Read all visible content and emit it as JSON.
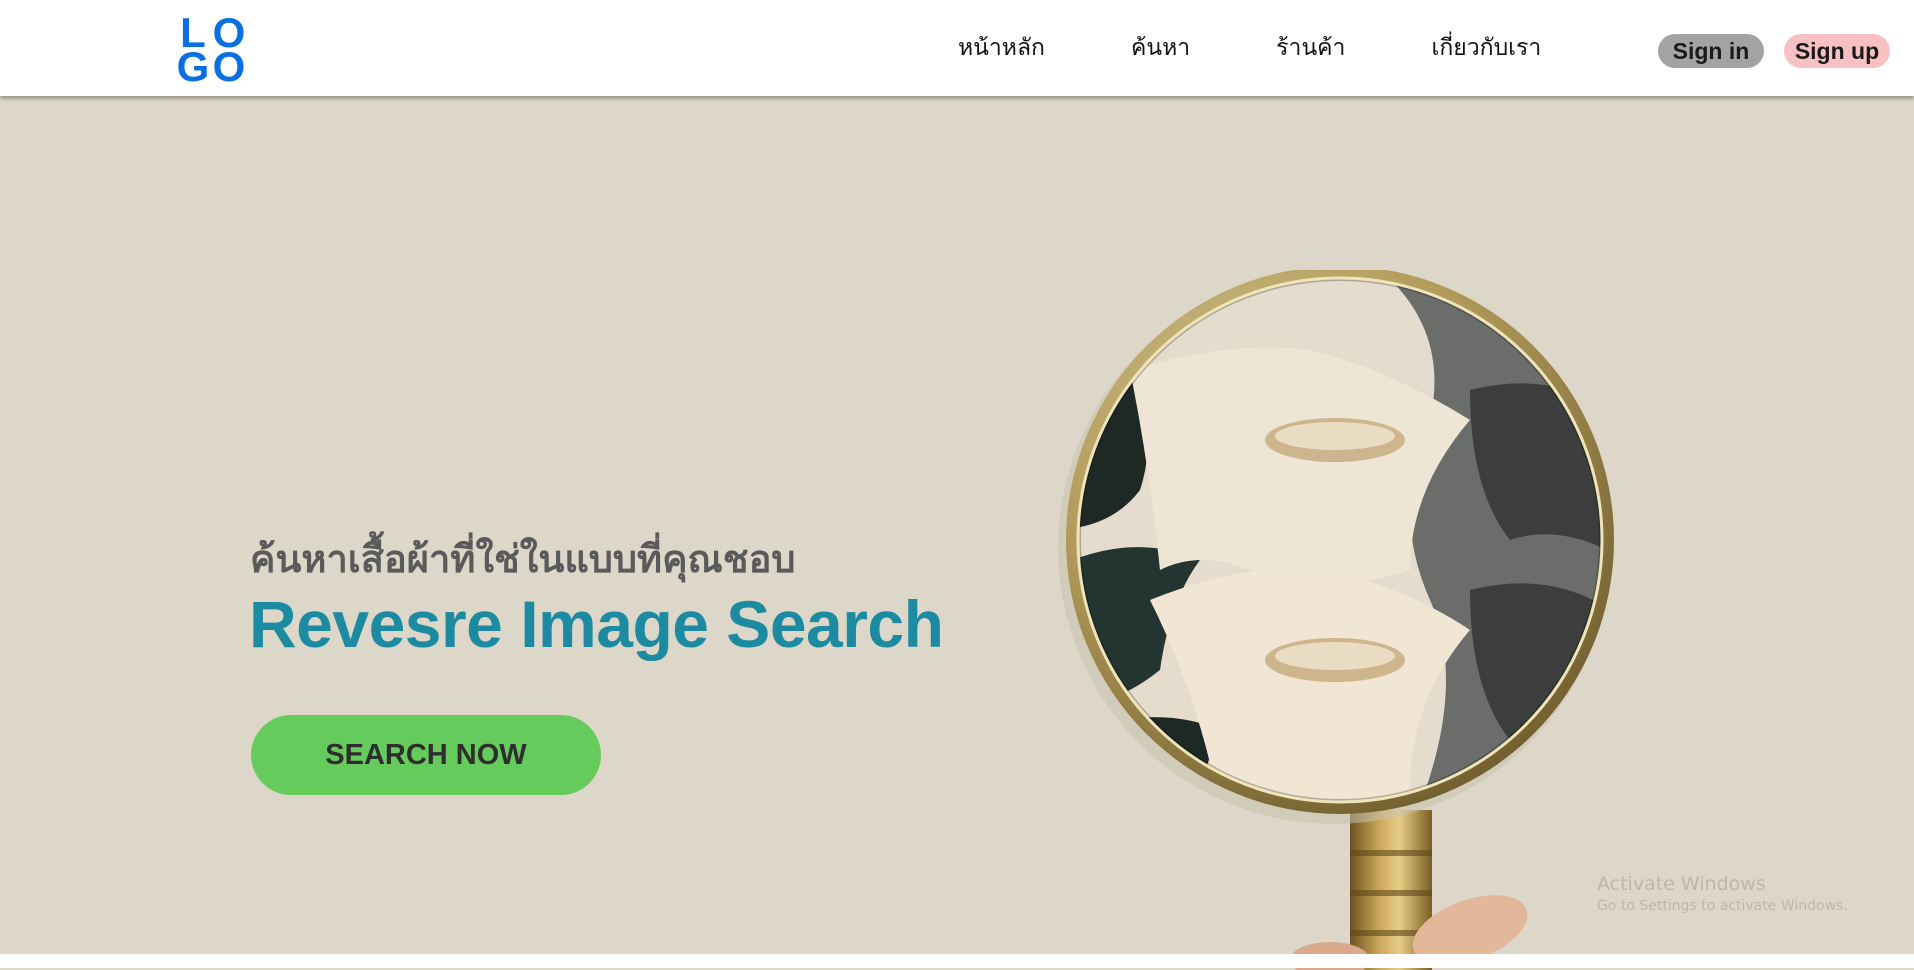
{
  "logo": {
    "letters": [
      "L",
      "O",
      "G",
      "O"
    ]
  },
  "nav": {
    "items": [
      {
        "label": "หน้าหลัก"
      },
      {
        "label": "ค้นหา"
      },
      {
        "label": "ร้านค้า"
      },
      {
        "label": "เกี่ยวกับเรา"
      }
    ],
    "signin_label": "Sign in",
    "signup_label": "Sign up"
  },
  "hero": {
    "subtitle": "ค้นหาเสื้อผ้าที่ใช่ในแบบที่คุณชอบ",
    "title": "Revesre Image Search",
    "cta_label": "SEARCH NOW"
  },
  "watermark": {
    "line1": "Activate Windows",
    "line2": "Go to Settings to activate Windows."
  },
  "colors": {
    "logo": "#0a6fe0",
    "hero_background": "#dcd7c8",
    "title": "#1c8aa0",
    "cta": "#64cb5c",
    "signin_bg": "#a3a3a3",
    "signup_bg": "#f8c0c2"
  }
}
